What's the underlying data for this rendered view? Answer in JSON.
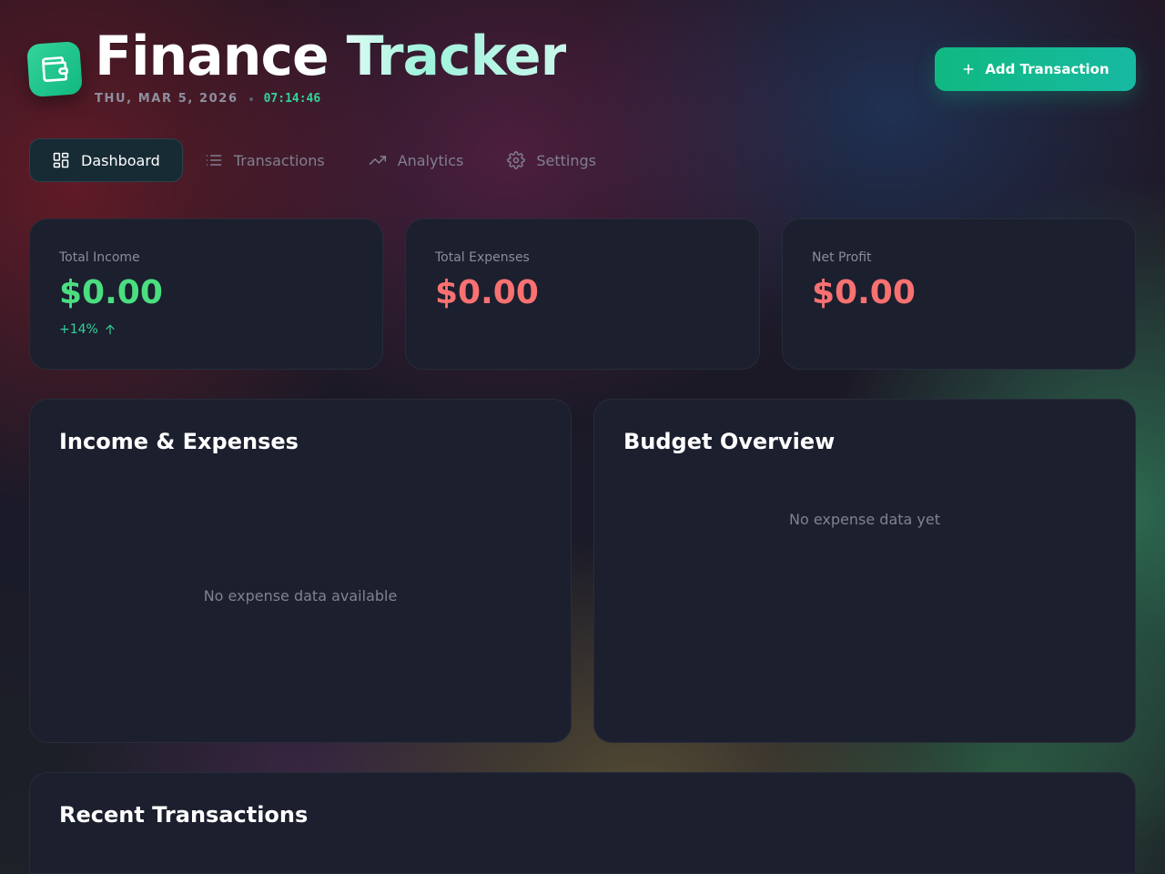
{
  "app": {
    "title": "Finance Tracker",
    "date": "THU, MAR 5, 2026",
    "time": "07:14:46",
    "icon": "wallet-icon"
  },
  "header": {
    "add_transaction_label": "Add Transaction"
  },
  "tabs": [
    {
      "label": "Dashboard",
      "icon": "dashboard-icon",
      "active": true
    },
    {
      "label": "Transactions",
      "icon": "list-icon",
      "active": false
    },
    {
      "label": "Analytics",
      "icon": "trending-up-icon",
      "active": false
    },
    {
      "label": "Settings",
      "icon": "gear-icon",
      "active": false
    }
  ],
  "stats": {
    "income": {
      "label": "Total Income",
      "value": "$0.00",
      "change": "+14%",
      "color": "#4ade80"
    },
    "expenses": {
      "label": "Total Expenses",
      "value": "$0.00",
      "color": "#f87171"
    },
    "net_profit": {
      "label": "Net Profit",
      "value": "$0.00",
      "color": "#f87171"
    }
  },
  "panels": {
    "income_expenses": {
      "title": "Income & Expenses",
      "empty": "No expense data available"
    },
    "budget_overview": {
      "title": "Budget Overview",
      "empty": "No expense data yet"
    },
    "recent_transactions": {
      "title": "Recent Transactions"
    }
  },
  "colors": {
    "accent": "#10b981",
    "income": "#4ade80",
    "expense": "#f87171",
    "card": "#1b1f2e"
  }
}
